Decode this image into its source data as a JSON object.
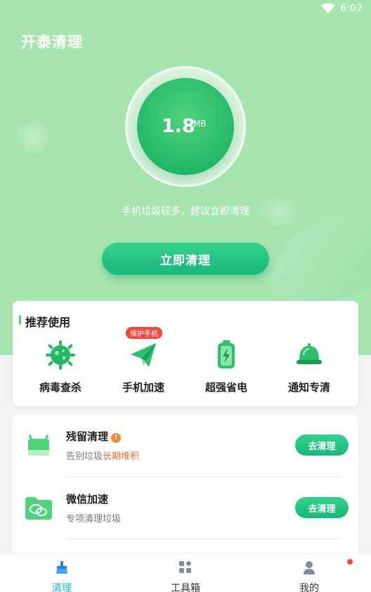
{
  "status_bar": {
    "time": "6:02",
    "wifi_icon": "wifi-icon"
  },
  "app": {
    "title": "开泰清理"
  },
  "scan": {
    "size_value": "1.8",
    "size_unit": "MB",
    "hint": "手机垃圾较多，建议立即清理"
  },
  "primary_action": {
    "label": "立即清理"
  },
  "recommend": {
    "title": "推荐使用",
    "badge": "保护手机",
    "tools": [
      {
        "label": "病毒查杀",
        "icon": "virus-icon"
      },
      {
        "label": "手机加速",
        "icon": "paper-plane-icon"
      },
      {
        "label": "超强省电",
        "icon": "battery-icon"
      },
      {
        "label": "通知专清",
        "icon": "bell-icon"
      }
    ]
  },
  "list": [
    {
      "name": "残留清理",
      "desc_prefix": "告别垃圾",
      "desc_highlight": "长期堆积",
      "action": "去清理",
      "icon": "android-residue-icon",
      "info_icon": "!"
    },
    {
      "name": "微信加速",
      "desc_prefix": "专项清理垃圾",
      "desc_highlight": "",
      "action": "去清理",
      "icon": "wechat-folder-icon"
    }
  ],
  "tabs": [
    {
      "label": "清理",
      "icon": "broom-icon",
      "active": true
    },
    {
      "label": "工具箱",
      "icon": "toolbox-icon",
      "active": false
    },
    {
      "label": "我的",
      "icon": "profile-icon",
      "active": false
    }
  ],
  "colors": {
    "hero_bg": "#a6e4b0",
    "accent": "#17b97c",
    "tab_active": "#27b4c4",
    "highlight": "#f06a2c",
    "badge": "#ef4b43"
  }
}
